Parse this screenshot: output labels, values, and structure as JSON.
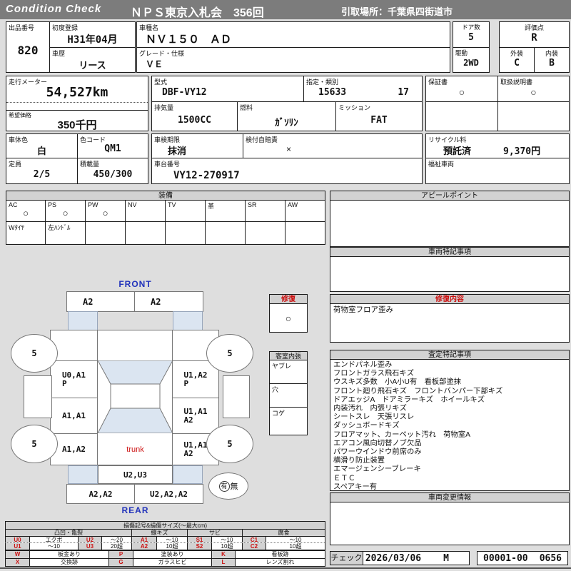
{
  "colors": {
    "accent_red": "#cc1111",
    "label_blue": "#2233bb",
    "shade_blue": "#dbe5f1",
    "header_gray": "#7c7c7c"
  },
  "header": {
    "brand": "Condition  Check",
    "title": "ＮＰＳ東京入札会　356回",
    "pickup": "引取場所：千葉県四街道市"
  },
  "info": {
    "lot_label": "出品番号",
    "lot": "820",
    "first_reg_label": "初度登録",
    "first_reg": "H31年04月",
    "history_label": "車歴",
    "history": "リース",
    "model_label": "車種名",
    "model": "ＮＶ１５０　ＡＤ",
    "grade_label": "グレード・仕様",
    "grade": "ＶＥ",
    "doors_label": "ドア数",
    "doors": "5",
    "drive_label": "駆動",
    "drive": "2WD",
    "score_label": "評価点",
    "score": "R",
    "exterior_label": "外装",
    "exterior": "C",
    "interior_label": "内装",
    "interior": "B",
    "odo_label": "走行メーター",
    "odo": "54,527km",
    "price_label": "希望価格",
    "price": "350千円",
    "type_label": "型式",
    "type": "DBF-VY12",
    "class_label": "指定・類別",
    "class1": "15633",
    "class2": "17",
    "disp_label": "排気量",
    "disp": "1500CC",
    "fuel_label": "燃料",
    "fuel": "ｶﾞｿﾘﾝ",
    "trans_label": "ミッション",
    "trans": "FAT",
    "warranty_label": "保証書",
    "warranty": "○",
    "manual_label": "取扱説明書",
    "manual": "○",
    "color_label": "車体色",
    "color": "白",
    "color_code_label": "色コード",
    "color_code": "QM1",
    "capacity_label": "定員",
    "capacity": "2/5",
    "load_label": "積載量",
    "load": "450/300",
    "inspection_label": "車検期限",
    "inspection": "抹消",
    "insurance_label": "検付自賠責",
    "insurance": "×",
    "vin_label": "車台番号",
    "vin": "VY12-270917",
    "recycle_label": "リサイクル料",
    "recycle_status": "預託済",
    "recycle_fee": "9,370円",
    "welfare_label": "福祉車両"
  },
  "equipment": {
    "title": "装備",
    "columns": [
      "AC",
      "PS",
      "PW",
      "NV",
      "TV",
      "革",
      "SR",
      "AW"
    ],
    "marks": [
      "○",
      "○",
      "○",
      "",
      "",
      "",
      "",
      ""
    ],
    "row2": [
      "Wﾀｲﾔ",
      "左ﾊﾝﾄﾞﾙ",
      "",
      "",
      "",
      "",
      "",
      ""
    ]
  },
  "panels": {
    "appeal_title": "アピールポイント",
    "notes_title": "車両特記事項",
    "repair_detail_title": "修復内容",
    "repair_detail": "荷物室フロア歪み",
    "assessment_title": "査定特記事項",
    "assessment_lines": [
      "エンドパネル歪み",
      "フロントガラス飛石キズ",
      "ウスキズ多数　小A小U有　看板部塗抹",
      "フロント廻り飛石キズ　フロントバンパー下部キズ",
      "ドアエッジA　ドアミラーキズ　ホイールキズ",
      "内装汚れ　内張リキズ",
      "シートスレ　天張リスレ",
      "ダッシュボードキズ",
      "フロアマット、カーペット汚れ　荷物室A",
      "エアコン風向切替ノブ欠品",
      "パワーウインドウ前席のみ",
      "横滑り防止装置",
      "エマージェンシーブレーキ",
      "ＥＴＣ",
      "スペアキー有"
    ],
    "change_title": "車両変更情報"
  },
  "repair_box": {
    "title": "修復",
    "mark": "○"
  },
  "cabin_box": {
    "title": "客室内張",
    "rows": [
      "ヤブレ",
      "穴",
      "コゲ"
    ]
  },
  "diagram": {
    "front_label": "FRONT",
    "rear_label": "REAR",
    "front_bumper": [
      "A2",
      "A2"
    ],
    "left_cells": [
      "U0,A1\nP",
      "A1,A1",
      "A1,A2"
    ],
    "right_cells": [
      "U1,A2\nP",
      "U1,A1\nA2",
      "U1,A1\nA2"
    ],
    "trunk": "trunk",
    "rear_window": "U2,U3",
    "rear_bumper": [
      "A2,A2",
      "U2,A2,A2"
    ],
    "tire": "5",
    "spare_yes": "有",
    "spare_no": "無"
  },
  "legend": {
    "title": "損傷記号&損傷サイズ(～最大cm)",
    "groups": [
      "凸凹・亀裂",
      "線キズ",
      "サビ",
      "腐食"
    ],
    "row1": [
      [
        "U0",
        "エクボ"
      ],
      [
        "U2",
        "～20"
      ],
      [
        "A1",
        "～10"
      ],
      [
        "S1",
        "～10"
      ],
      [
        "C1",
        "～10"
      ]
    ],
    "row2": [
      [
        "U1",
        "～10"
      ],
      [
        "U3",
        "20超"
      ],
      [
        "A2",
        "10超"
      ],
      [
        "S2",
        "10超"
      ],
      [
        "C2",
        "10超"
      ]
    ],
    "row3": [
      [
        "W",
        "板金あり"
      ],
      [
        "P",
        "塗装あり"
      ],
      [
        "K",
        "看板跡"
      ]
    ],
    "row4": [
      [
        "X",
        "交換跡"
      ],
      [
        "G",
        "ガラスヒビ"
      ],
      [
        "L",
        "レンズ割れ"
      ]
    ]
  },
  "footer": {
    "check_label": "チェック",
    "date": "2026/03/06",
    "inspector": "M",
    "code1": "00001-00",
    "code2": "0656"
  }
}
